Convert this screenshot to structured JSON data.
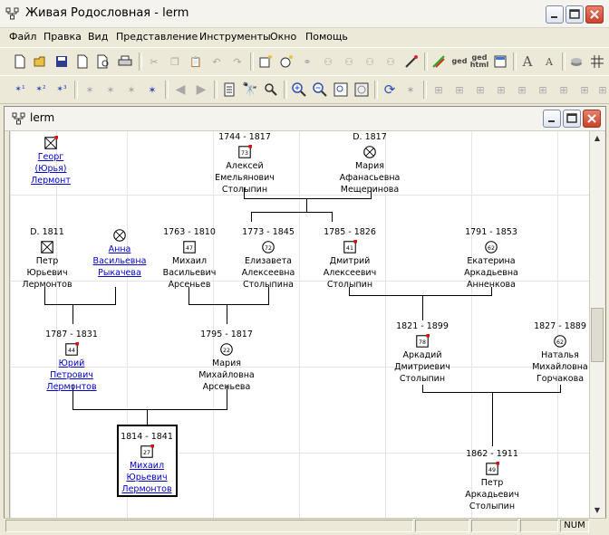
{
  "window": {
    "title": "Живая Родословная - lerm"
  },
  "menu": [
    "Файл",
    "Правка",
    "Вид",
    "Представление",
    "Инструменты",
    "Окно",
    "Помощь"
  ],
  "toolbar1": {
    "ged_label": "ged",
    "gedhtml_label_1": "ged",
    "gedhtml_label_2": "html"
  },
  "document": {
    "title": "lerm"
  },
  "status": {
    "num": "NUM"
  },
  "tree": {
    "people": [
      {
        "id": "georg",
        "dates": "",
        "age": "",
        "sex": "m",
        "deceased": true,
        "marker": true,
        "lines": [
          "Георг",
          "(Юрья)",
          "Лермонт"
        ],
        "link": true
      },
      {
        "id": "aleksey",
        "dates": "1744 - 1817",
        "age": "73",
        "sex": "m",
        "deceased": false,
        "marker": true,
        "lines": [
          "Алексей",
          "Емельянович",
          "Столыпин"
        ],
        "link": false
      },
      {
        "id": "maria_m",
        "dates": "D. 1817",
        "age": "",
        "sex": "f",
        "deceased": true,
        "marker": false,
        "lines": [
          "Мария",
          "Афанасьевна",
          "Мещеринова"
        ],
        "link": false
      },
      {
        "id": "petr_l",
        "dates": "D. 1811",
        "age": "",
        "sex": "m",
        "deceased": true,
        "marker": false,
        "lines": [
          "Петр",
          "Юрьевич",
          "Лермонтов"
        ],
        "link": false
      },
      {
        "id": "anna",
        "dates": "",
        "age": "",
        "sex": "f",
        "deceased": true,
        "marker": false,
        "lines": [
          "Анна",
          "Васильевна",
          "Рыкачева"
        ],
        "link": true
      },
      {
        "id": "mikhail_a",
        "dates": "1763 - 1810",
        "age": "47",
        "sex": "m",
        "deceased": false,
        "marker": false,
        "lines": [
          "Михаил",
          "Васильевич",
          "Арсеньев"
        ],
        "link": false
      },
      {
        "id": "elizaveta",
        "dates": "1773 - 1845",
        "age": "72",
        "sex": "f",
        "deceased": false,
        "marker": false,
        "lines": [
          "Елизавета",
          "Алексеевна",
          "Столыпина"
        ],
        "link": false
      },
      {
        "id": "dmitriy",
        "dates": "1785 - 1826",
        "age": "41",
        "sex": "m",
        "deceased": false,
        "marker": true,
        "lines": [
          "Дмитрий",
          "Алексеевич",
          "Столыпин"
        ],
        "link": false
      },
      {
        "id": "ekaterina",
        "dates": "1791 - 1853",
        "age": "62",
        "sex": "f",
        "deceased": false,
        "marker": false,
        "lines": [
          "Екатерина",
          "Аркадьевна",
          "Анненкова"
        ],
        "link": false
      },
      {
        "id": "yuriy",
        "dates": "1787 - 1831",
        "age": "44",
        "sex": "m",
        "deceased": false,
        "marker": true,
        "lines": [
          "Юрий",
          "Петрович",
          "Лермонтов"
        ],
        "link": true
      },
      {
        "id": "maria_a",
        "dates": "1795 - 1817",
        "age": "22",
        "sex": "f",
        "deceased": false,
        "marker": false,
        "lines": [
          "Мария",
          "Михайловна",
          "Арсеньева"
        ],
        "link": false
      },
      {
        "id": "arkadiy",
        "dates": "1821 - 1899",
        "age": "78",
        "sex": "m",
        "deceased": false,
        "marker": true,
        "lines": [
          "Аркадий",
          "Дмитриевич",
          "Столыпин"
        ],
        "link": false
      },
      {
        "id": "natalya",
        "dates": "1827 - 1889",
        "age": "62",
        "sex": "f",
        "deceased": false,
        "marker": false,
        "lines": [
          "Наталья",
          "Михайловна",
          "Горчакова"
        ],
        "link": false
      },
      {
        "id": "mikhail_l",
        "dates": "1814 - 1841",
        "age": "27",
        "sex": "m",
        "deceased": false,
        "marker": true,
        "lines": [
          "Михаил",
          "Юрьевич",
          "Лермонтов"
        ],
        "link": true
      },
      {
        "id": "petr_s",
        "dates": "1862 - 1911",
        "age": "49",
        "sex": "m",
        "deceased": false,
        "marker": true,
        "lines": [
          "Петр",
          "Аркадьевич",
          "Столыпин"
        ],
        "link": false
      }
    ]
  }
}
